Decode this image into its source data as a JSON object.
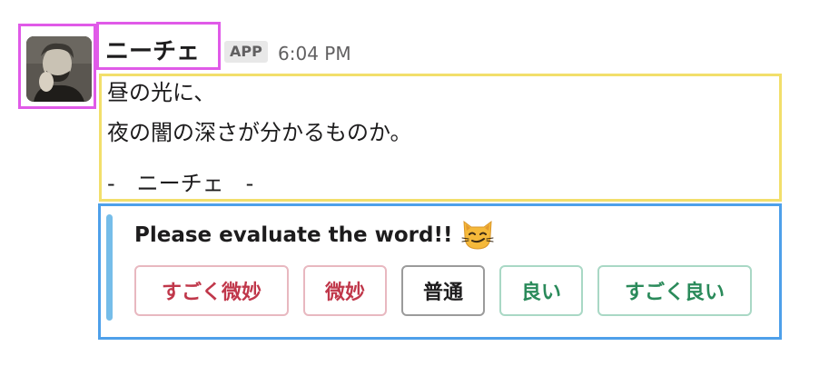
{
  "message": {
    "sender_name": "ニーチェ",
    "app_badge": "APP",
    "timestamp": "6:04 PM",
    "lines": [
      "昼の光に、",
      "夜の闇の深さが分かるものか。",
      "-　ニーチェ　-"
    ]
  },
  "attachment": {
    "title": "Please evaluate the word!!",
    "title_emoji": "smirk-cat-emoji",
    "accent_color": "#76bde9",
    "buttons": [
      {
        "label": "すごく微妙",
        "style": "danger"
      },
      {
        "label": "微妙",
        "style": "danger"
      },
      {
        "label": "普通",
        "style": "default"
      },
      {
        "label": "良い",
        "style": "primary"
      },
      {
        "label": "すごく良い",
        "style": "primary"
      }
    ]
  },
  "colors": {
    "outline_pink": "#e05ae8",
    "outline_yellow": "#f2df6b",
    "outline_blue": "#4ea0ea",
    "danger": "#c0374a",
    "primary": "#2a8a5a"
  }
}
